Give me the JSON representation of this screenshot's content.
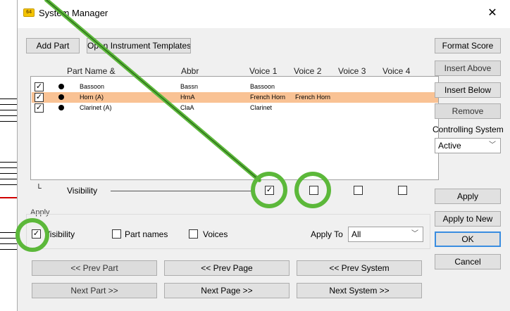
{
  "window": {
    "title": "System Manager",
    "app_icon": "sibelius-icon",
    "close_glyph": "✕"
  },
  "top_buttons": {
    "add_part": "Add Part",
    "open_templates": "Open Instrument Templates"
  },
  "columns": {
    "part_name": "Part Name  &",
    "abbr": "Abbr",
    "voice1": "Voice 1",
    "voice2": "Voice 2",
    "voice3": "Voice 3",
    "voice4": "Voice 4"
  },
  "parts": [
    {
      "checked": true,
      "name": "Bassoon",
      "abbr": "Bassn",
      "voice1": "Bassoon",
      "voice2": "",
      "selected": false
    },
    {
      "checked": true,
      "name": "Horn (A)",
      "abbr": "HrnA",
      "voice1": "French Horn",
      "voice2": "French Horn",
      "selected": true
    },
    {
      "checked": true,
      "name": "Clarinet (A)",
      "abbr": "ClaA",
      "voice1": "Clarinet",
      "voice2": "",
      "selected": false
    }
  ],
  "visibility_row": {
    "label": "Visibility",
    "voice_checks": [
      true,
      false,
      false,
      false
    ]
  },
  "side": {
    "format_score": "Format Score",
    "insert_above": "Insert Above",
    "insert_below": "Insert Below",
    "remove": "Remove",
    "controlling_label": "Controlling System",
    "controlling_value": "Active",
    "apply": "Apply",
    "apply_new": "Apply to New",
    "ok": "OK",
    "cancel": "Cancel"
  },
  "apply_group": {
    "label": "Apply",
    "visibility": "Visibility",
    "visibility_checked": true,
    "part_names": "Part names",
    "voices": "Voices",
    "apply_to_label": "Apply To",
    "apply_to_value": "All"
  },
  "nav": {
    "prev_part": "<< Prev Part",
    "prev_page": "<< Prev Page",
    "prev_system": "<< Prev System",
    "next_part": "Next Part >>",
    "next_page": "Next Page >>",
    "next_system": "Next System >>"
  },
  "colors": {
    "selected_row": "#f9c294",
    "highlight": "#5cb83a"
  }
}
